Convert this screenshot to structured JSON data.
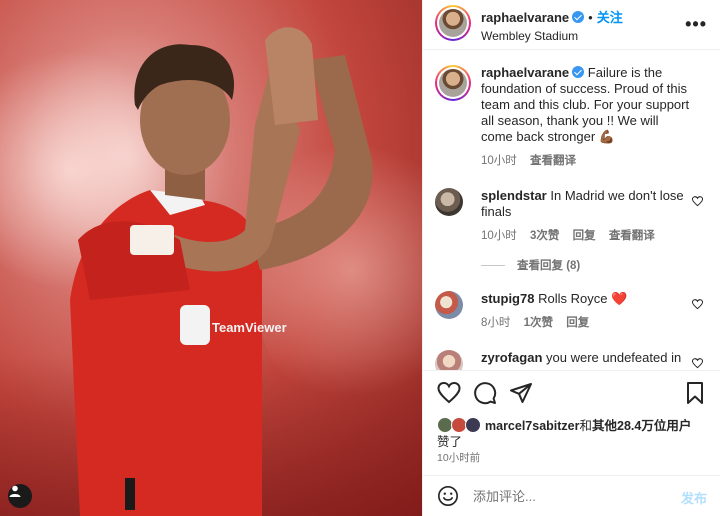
{
  "post": {
    "username": "raphaelvarane",
    "location": "Wembley Stadium",
    "follow_label": "关注",
    "dot": "•",
    "more": "•••",
    "photo_jersey_text": "TeamViewer"
  },
  "caption": {
    "username": "raphaelvarane",
    "text": "Failure is the foundation of success. Proud of this team and this club. For your support all season, thank you !! We will come back stronger 💪🏾",
    "time": "10小时",
    "translate": "查看翻译"
  },
  "comments": [
    {
      "username": "splendstar",
      "text": "In Madrid we don't lose finals",
      "time": "10小时",
      "likes": "3次赞",
      "reply": "回复",
      "translate": "查看翻译"
    },
    {
      "username": "stupig78",
      "text": "Rolls Royce ❤️",
      "time": "8小时",
      "likes": "1次赞",
      "reply": "回复"
    },
    {
      "username": "zyrofagan",
      "text": "you were undefeated in"
    }
  ],
  "view_replies": "查看回复 (8)",
  "likes": {
    "user": "marcel7sabitzer",
    "connector": "和",
    "others": "其他28.4万位用户",
    "suffix": "赞了"
  },
  "post_time": "10小时前",
  "add_comment": {
    "placeholder": "添加评论...",
    "post_label": "发布"
  },
  "colors": {
    "accent": "#0095f6",
    "verified": "#3897f0",
    "muted": "#737373",
    "jersey_red": "#d42a22"
  }
}
